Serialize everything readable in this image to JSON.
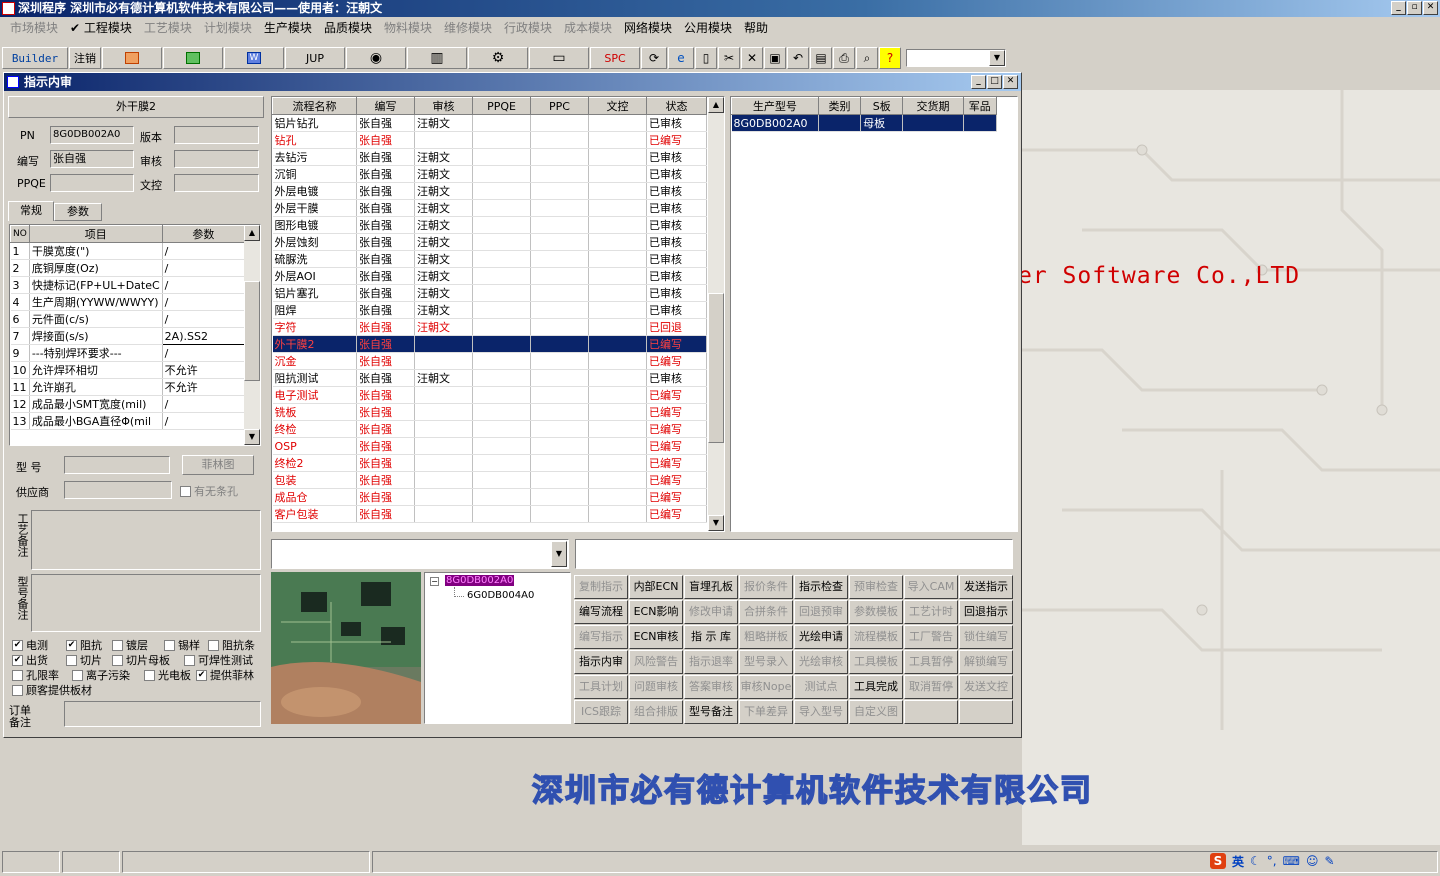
{
  "app": {
    "title": "深圳程序   深圳市必有德计算机软件技术有限公司——使用者：汪朝文"
  },
  "menu": [
    {
      "label": "市场模块",
      "dis": true
    },
    {
      "label": "✔ 工程模块",
      "dis": false
    },
    {
      "label": "工艺模块",
      "dis": true
    },
    {
      "label": "计划模块",
      "dis": true
    },
    {
      "label": "生产模块",
      "dis": false
    },
    {
      "label": "品质模块",
      "dis": false
    },
    {
      "label": "物料模块",
      "dis": true
    },
    {
      "label": "维修模块",
      "dis": true
    },
    {
      "label": "行政模块",
      "dis": true
    },
    {
      "label": "成本模块",
      "dis": true
    },
    {
      "label": "网络模块",
      "dis": false
    },
    {
      "label": "公用模块",
      "dis": false
    },
    {
      "label": "帮助",
      "dis": false
    }
  ],
  "toolbar": {
    "builder": "Builder",
    "logout": "注销",
    "jup": "JUP",
    "spc": "SPC"
  },
  "child": {
    "title": "指示内审"
  },
  "left": {
    "header": "外干膜2",
    "pn_label": "PN",
    "pn": "8G0DB002A0",
    "version_label": "版本",
    "writer_label": "编写",
    "writer": "张自强",
    "review_label": "审核",
    "ppqe_label": "PPQE",
    "doc_label": "文控",
    "tab1": "常规",
    "tab2": "参数",
    "grid_headers": {
      "no": "NO",
      "item": "项目",
      "param": "参数"
    },
    "params": [
      {
        "no": "1",
        "item": "干膜宽度(\")",
        "val": "/"
      },
      {
        "no": "2",
        "item": "底铜厚度(Oz)",
        "val": "/"
      },
      {
        "no": "3",
        "item": "快捷标记(FP+UL+DateC",
        "val": "/"
      },
      {
        "no": "4",
        "item": "生产周期(YYWW/WWYY)",
        "val": "/"
      },
      {
        "no": "6",
        "item": "元件面(c/s)",
        "val": "/"
      },
      {
        "no": "7",
        "item": "焊接面(s/s)",
        "val": "2A).SS2"
      },
      {
        "no": "9",
        "item": "---特别焊环要求---",
        "val": "/"
      },
      {
        "no": "10",
        "item": "允许焊环相切",
        "val": "不允许"
      },
      {
        "no": "11",
        "item": "允许崩孔",
        "val": "不允许"
      },
      {
        "no": "12",
        "item": "成品最小SMT宽度(mil)",
        "val": "/"
      },
      {
        "no": "13",
        "item": "成品最小BGA直径Φ(mil",
        "val": "/"
      }
    ],
    "model_label": "型 号",
    "fei_btn": "菲林图",
    "supplier_label": "供应商",
    "hole_chk": "有无条孔",
    "craft_note": "工艺备注",
    "model_note": "型号备注",
    "order_note": "订单备注",
    "checks": [
      {
        "label": "电测",
        "on": true
      },
      {
        "label": "阻抗",
        "on": true
      },
      {
        "label": "镀层",
        "on": false
      },
      {
        "label": "锡样",
        "on": false
      },
      {
        "label": "阻抗条",
        "on": false
      },
      {
        "label": "出货",
        "on": true
      },
      {
        "label": "切片",
        "on": false
      },
      {
        "label": "切片母板",
        "on": false
      },
      {
        "label": "可焊性测试",
        "on": false
      },
      {
        "label": "孔限率",
        "on": false
      },
      {
        "label": "离子污染",
        "on": false
      },
      {
        "label": "光电板",
        "on": false
      },
      {
        "label": "提供菲林",
        "on": true
      },
      {
        "label": "顾客提供板材",
        "on": false
      }
    ]
  },
  "flow": {
    "headers": [
      "流程名称",
      "编写",
      "审核",
      "PPQE",
      "PPC",
      "文控",
      "状态"
    ],
    "rows": [
      {
        "n": "铝片钻孔",
        "w": "张自强",
        "r": "汪朝文",
        "s": "已审核",
        "red": false
      },
      {
        "n": "钻孔",
        "w": "张自强",
        "r": "",
        "s": "已编写",
        "red": true
      },
      {
        "n": "去钻污",
        "w": "张自强",
        "r": "汪朝文",
        "s": "已审核",
        "red": false
      },
      {
        "n": "沉铜",
        "w": "张自强",
        "r": "汪朝文",
        "s": "已审核",
        "red": false
      },
      {
        "n": "外层电镀",
        "w": "张自强",
        "r": "汪朝文",
        "s": "已审核",
        "red": false
      },
      {
        "n": "外层干膜",
        "w": "张自强",
        "r": "汪朝文",
        "s": "已审核",
        "red": false
      },
      {
        "n": "图形电镀",
        "w": "张自强",
        "r": "汪朝文",
        "s": "已审核",
        "red": false
      },
      {
        "n": "外层蚀刻",
        "w": "张自强",
        "r": "汪朝文",
        "s": "已审核",
        "red": false
      },
      {
        "n": "硫脲洗",
        "w": "张自强",
        "r": "汪朝文",
        "s": "已审核",
        "red": false
      },
      {
        "n": "外层AOI",
        "w": "张自强",
        "r": "汪朝文",
        "s": "已审核",
        "red": false
      },
      {
        "n": "铝片塞孔",
        "w": "张自强",
        "r": "汪朝文",
        "s": "已审核",
        "red": false
      },
      {
        "n": "阻焊",
        "w": "张自强",
        "r": "汪朝文",
        "s": "已审核",
        "red": false
      },
      {
        "n": "字符",
        "w": "张自强",
        "r": "汪朝文",
        "s": "已回退",
        "red": true
      },
      {
        "n": "外干膜2",
        "w": "张自强",
        "r": "",
        "s": "已编写",
        "red": true,
        "sel": true
      },
      {
        "n": "沉金",
        "w": "张自强",
        "r": "",
        "s": "已编写",
        "red": true
      },
      {
        "n": "阻抗测试",
        "w": "张自强",
        "r": "汪朝文",
        "s": "已审核",
        "red": false
      },
      {
        "n": "电子测试",
        "w": "张自强",
        "r": "",
        "s": "已编写",
        "red": true
      },
      {
        "n": "铣板",
        "w": "张自强",
        "r": "",
        "s": "已编写",
        "red": true
      },
      {
        "n": "终检",
        "w": "张自强",
        "r": "",
        "s": "已编写",
        "red": true
      },
      {
        "n": "OSP",
        "w": "张自强",
        "r": "",
        "s": "已编写",
        "red": true
      },
      {
        "n": "终检2",
        "w": "张自强",
        "r": "",
        "s": "已编写",
        "red": true
      },
      {
        "n": "包装",
        "w": "张自强",
        "r": "",
        "s": "已编写",
        "red": true
      },
      {
        "n": "成品仓",
        "w": "张自强",
        "r": "",
        "s": "已编写",
        "red": true
      },
      {
        "n": "客户包装",
        "w": "张自强",
        "r": "",
        "s": "已编写",
        "red": true
      }
    ]
  },
  "prod": {
    "headers": [
      "生产型号",
      "类别",
      "S板",
      "交货期",
      "军品"
    ],
    "rows": [
      {
        "model": "8G0DB002A0",
        "type": "",
        "sboard": "母板",
        "date": "",
        "mil": ""
      }
    ]
  },
  "tree": {
    "root": "8G0DB002A0",
    "child": "6G0DB004A0"
  },
  "actions": [
    [
      "复制指示",
      "内部ECN",
      "盲埋孔板",
      "报价条件",
      "指示检查",
      "预审检查",
      "导入CAM",
      "发送指示"
    ],
    [
      "编写流程",
      "ECN影响",
      "修改申请",
      "合拼条件",
      "回退预审",
      "参数模板",
      "工艺计时",
      "回退指示"
    ],
    [
      "编写指示",
      "ECN审核",
      "指 示 库",
      "粗略拼板",
      "光绘申请",
      "流程模板",
      "工厂警告",
      "锁住编写"
    ],
    [
      "指示内审",
      "风险警告",
      "指示退率",
      "型号录入",
      "光绘审核",
      "工具模板",
      "工具暂停",
      "解锁编写"
    ],
    [
      "工具计划",
      "问题审核",
      "答案审核",
      "审核Nope",
      "测试点",
      "工具完成",
      "取消暂停",
      "发送文控"
    ],
    [
      "ICS跟踪",
      "组合排版",
      "型号备注",
      "下单差异",
      "导入型号",
      "自定义图",
      "",
      ""
    ]
  ],
  "actions_enabled": [
    [
      false,
      true,
      true,
      false,
      true,
      false,
      false,
      true
    ],
    [
      true,
      true,
      false,
      false,
      false,
      false,
      false,
      true
    ],
    [
      false,
      true,
      true,
      false,
      true,
      false,
      false,
      false
    ],
    [
      true,
      false,
      false,
      false,
      false,
      false,
      false,
      false
    ],
    [
      false,
      false,
      false,
      false,
      false,
      true,
      false,
      false
    ],
    [
      false,
      false,
      true,
      false,
      false,
      false,
      false,
      false
    ]
  ],
  "watermark": {
    "en": "er Software Co.,LTD",
    "cn": "深圳市必有德计算机软件技术有限公司"
  },
  "tray": {
    "ime": "英"
  }
}
